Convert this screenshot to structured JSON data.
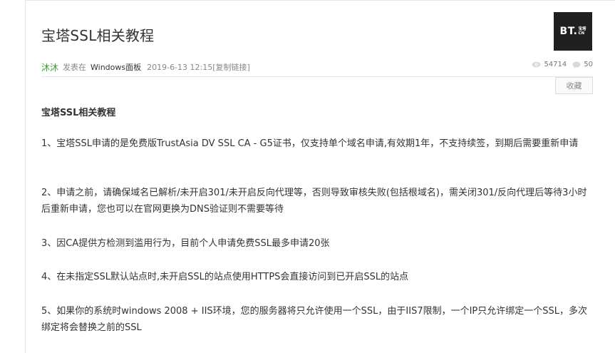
{
  "post": {
    "title": "宝塔SSL相关教程",
    "author": "沐沐",
    "posted_in": "发表在",
    "forum": "Windows面板",
    "date": "2019-6-13 12:15",
    "copy_link": "[复制链接]",
    "views": "54714",
    "replies": "50"
  },
  "logo": {
    "main": "BT.",
    "sub_top": "宝塔",
    "sub_bottom": "CN"
  },
  "actions": {
    "favorite_label": "收藏"
  },
  "content": {
    "heading": "宝塔SSL相关教程",
    "paragraphs": [
      "1、宝塔SSL申请的是免费版TrustAsia DV SSL CA - G5证书，仅支持单个域名申请,有效期1年，不支持续签，到期后需要重新申请",
      "2、申请之前，请确保域名已解析/未开启301/未开启反向代理等，否则导致审核失败(包括根域名)，需关闭301/反向代理后等待3小时后重新申请，您也可以在官网更换为DNS验证则不需要等待",
      "3、因CA提供方检测到滥用行为，目前个人申请免费SSL最多申请20张",
      "4、在未指定SSL默认站点时,未开启SSL的站点使用HTTPS会直接访问到已开启SSL的站点",
      "5、如果你的系统时windows 2008 + IIS环境，您的服务器将只允许使用一个SSL，由于IIS7限制，一个IP只允许绑定一个SSL，多次绑定将会替换之前的SSL"
    ]
  },
  "icons": {
    "views": "eye-icon",
    "replies": "comment-icon"
  }
}
